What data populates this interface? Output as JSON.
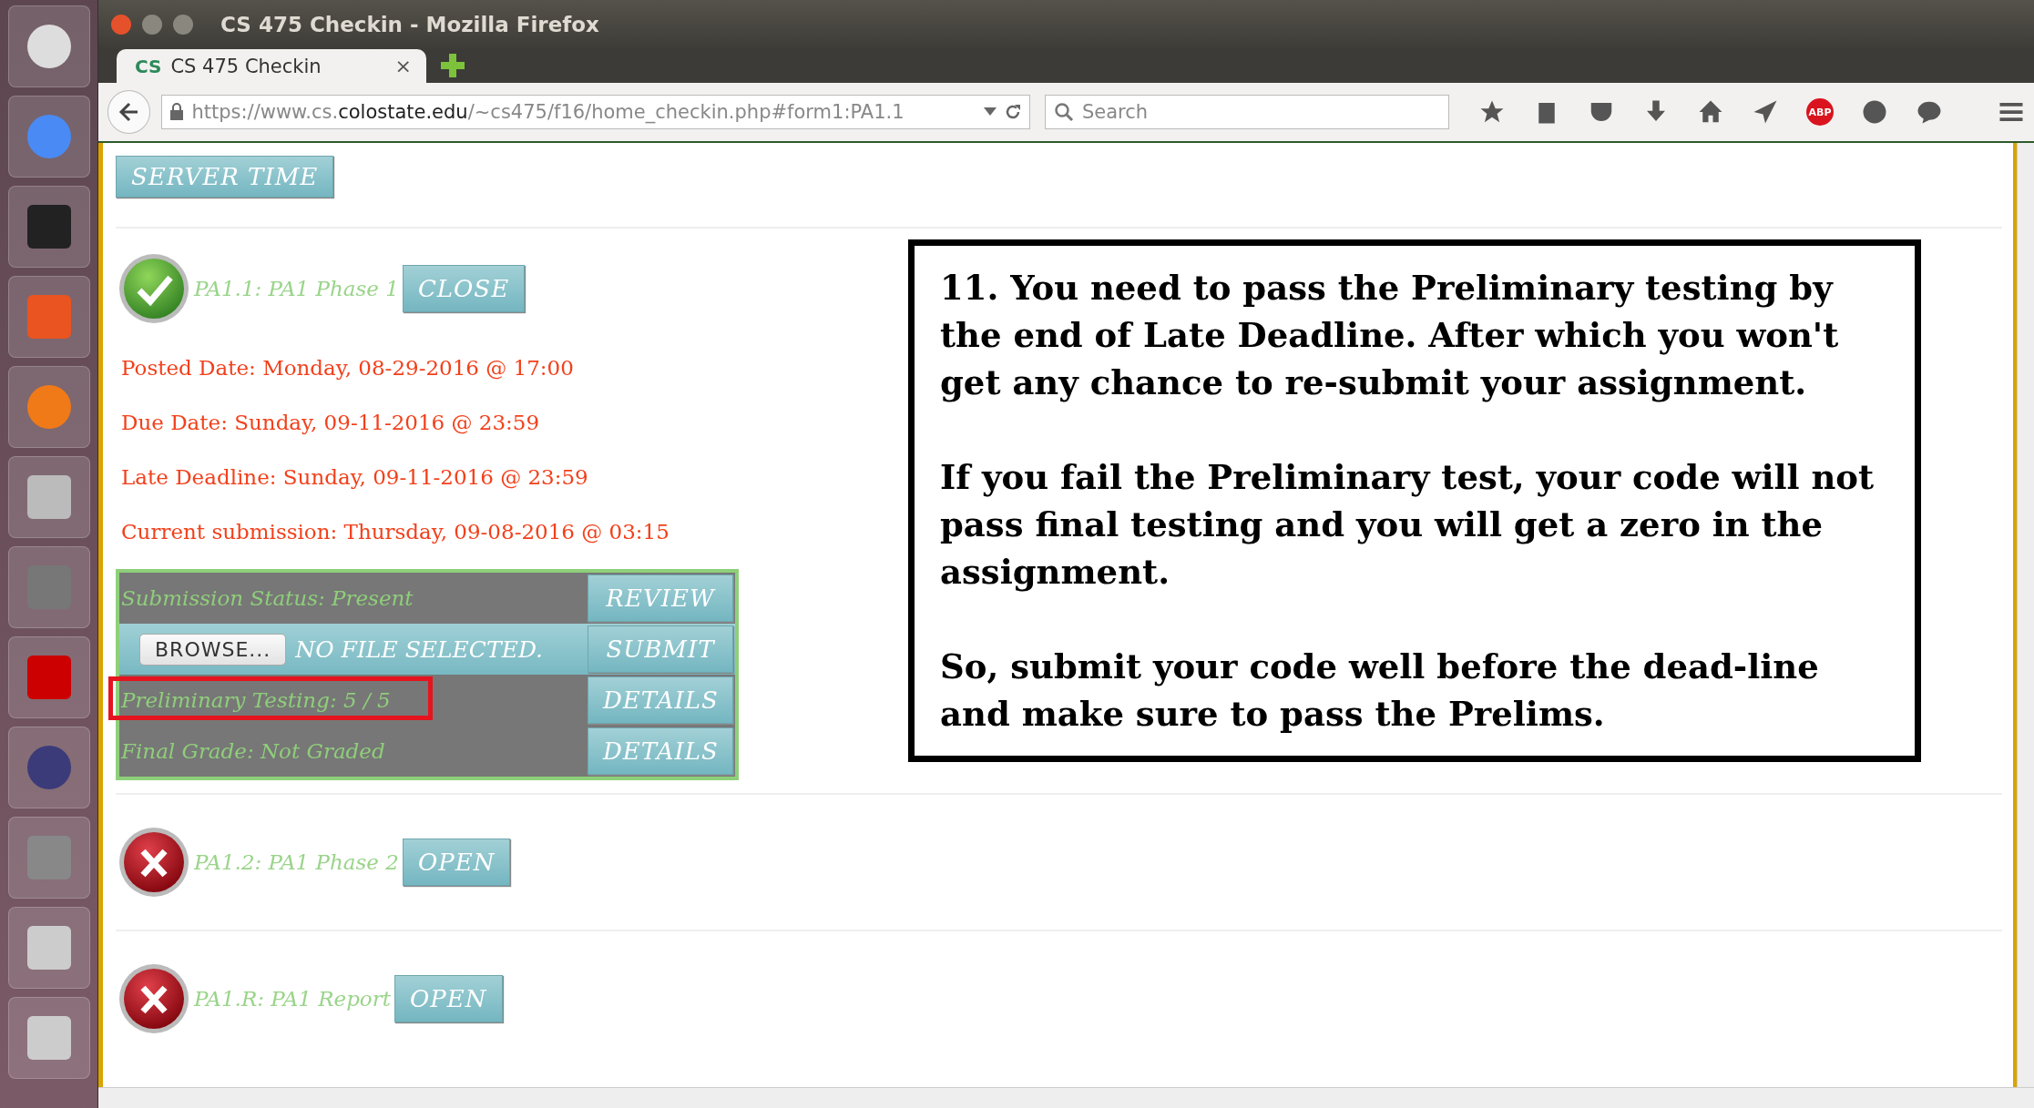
{
  "window": {
    "title": "CS 475 Checkin - Mozilla Firefox"
  },
  "tabs": [
    {
      "favicon": "CS",
      "label": "CS 475 Checkin",
      "close": "×",
      "selected": true
    }
  ],
  "address_bar": {
    "url_prefix": "https://www.cs.",
    "url_domain": "colostate.edu",
    "url_path": "/~cs475/f16/home_checkin.php#form1:PA1.1"
  },
  "search": {
    "placeholder": "Search"
  },
  "toolbar": {
    "adblock_label": "ABP"
  },
  "page": {
    "server_time_button": "SERVER TIME",
    "assignments": [
      {
        "kind": "passed",
        "title": "PA1.1: PA1 Phase 1",
        "action": "CLOSE",
        "dates": [
          "Posted Date: Monday, 08-29-2016 @ 17:00",
          "Due Date: Sunday, 09-11-2016 @ 23:59",
          "Late Deadline: Sunday, 09-11-2016 @ 23:59",
          "Current submission: Thursday, 09-08-2016 @ 03:15"
        ],
        "panel": [
          {
            "kind": "status",
            "text": "Submission Status: Present",
            "highlighted": false,
            "button": "REVIEW"
          },
          {
            "kind": "upload",
            "browse": "BROWSE...",
            "file_label": "NO FILE SELECTED.",
            "button": "SUBMIT"
          },
          {
            "kind": "status",
            "text": "Preliminary Testing: 5 / 5",
            "highlighted": true,
            "button": "DETAILS"
          },
          {
            "kind": "status",
            "text": "Final Grade: Not Graded",
            "highlighted": false,
            "button": "DETAILS"
          }
        ]
      },
      {
        "kind": "failed",
        "title": "PA1.2: PA1 Phase 2",
        "action": "OPEN"
      },
      {
        "kind": "failed",
        "title": "PA1.R: PA1 Report",
        "action": "OPEN"
      }
    ],
    "callout": {
      "paragraphs": [
        "11. You need to pass the Preliminary testing by the end of Late Deadline. After which you won't get any chance to re-submit your assignment.",
        "If you fail the Preliminary test, your code will not pass final testing and you will get a zero in the assignment.",
        "So, submit your code well before the dead-line and make sure to pass the Prelims."
      ]
    }
  }
}
